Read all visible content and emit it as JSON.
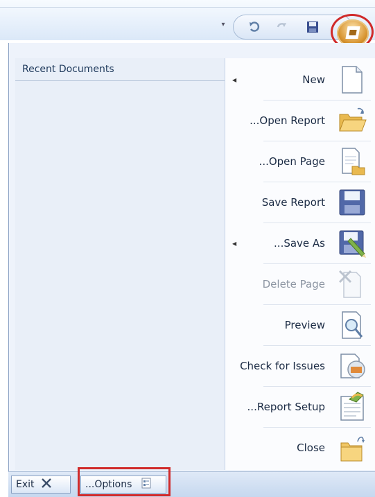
{
  "quick_access": {
    "dropdown_icon": "customize-qat-icon",
    "buttons": [
      "undo-icon",
      "redo-icon",
      "save-icon"
    ],
    "app_button_icon": "application-menu-icon"
  },
  "recent": {
    "title": "Recent Documents"
  },
  "commands": [
    {
      "label": "New",
      "icon": "new-document-icon",
      "has_arrow": true,
      "enabled": true
    },
    {
      "label": "...Open Report",
      "icon": "open-folder-icon",
      "has_arrow": false,
      "enabled": true
    },
    {
      "label": "...Open Page",
      "icon": "open-page-icon",
      "has_arrow": false,
      "enabled": true
    },
    {
      "label": "Save Report",
      "icon": "save-disk-icon",
      "has_arrow": false,
      "enabled": true
    },
    {
      "label": "...Save As",
      "icon": "save-as-icon",
      "has_arrow": true,
      "enabled": true
    },
    {
      "label": "Delete Page",
      "icon": "delete-page-icon",
      "has_arrow": false,
      "enabled": false
    },
    {
      "label": "Preview",
      "icon": "preview-magnifier-icon",
      "has_arrow": false,
      "enabled": true
    },
    {
      "label": "Check for Issues",
      "icon": "check-issues-icon",
      "has_arrow": false,
      "enabled": true
    },
    {
      "label": "...Report Setup",
      "icon": "report-setup-icon",
      "has_arrow": false,
      "enabled": true
    },
    {
      "label": "Close",
      "icon": "close-folder-icon",
      "has_arrow": false,
      "enabled": true
    }
  ],
  "footer": {
    "exit_label": "Exit",
    "options_label": "...Options"
  },
  "colors": {
    "highlight": "#d02a2a",
    "accent": "#1e395b"
  }
}
